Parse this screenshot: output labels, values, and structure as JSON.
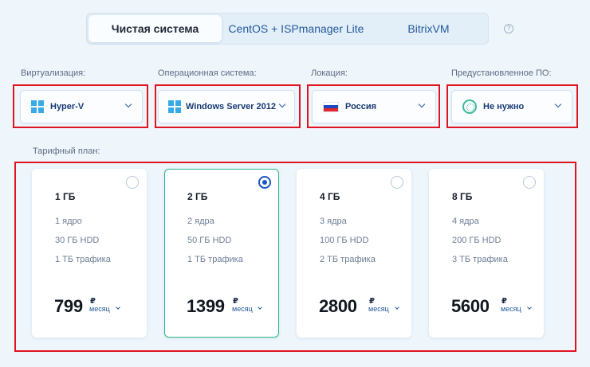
{
  "tabs": [
    {
      "label": "Чистая система",
      "active": true
    },
    {
      "label": "CentOS + ISPmanager Lite",
      "active": false
    },
    {
      "label": "BitrixVM",
      "active": false
    }
  ],
  "help_icon": "?",
  "filters": {
    "virtualization": {
      "label": "Виртуализация:",
      "value": "Hyper-V",
      "icon": "windows-logo"
    },
    "os": {
      "label": "Операционная система:",
      "value": "Windows Server 2012",
      "icon": "windows-logo"
    },
    "location": {
      "label": "Локация:",
      "value": "Россия",
      "icon": "russia-flag"
    },
    "software": {
      "label": "Предустановленное ПО:",
      "value": "Не нужно",
      "icon": "none-icon"
    }
  },
  "plans_label": "Тарифный план:",
  "plans": [
    {
      "ram": "1 ГБ",
      "cores": "1 ядро",
      "disk": "30 ГБ HDD",
      "traffic": "1 ТБ трафика",
      "price": "799",
      "currency": "₽",
      "period": "месяц",
      "selected": false
    },
    {
      "ram": "2 ГБ",
      "cores": "2 ядра",
      "disk": "50 ГБ HDD",
      "traffic": "1 ТБ трафика",
      "price": "1399",
      "currency": "₽",
      "period": "месяц",
      "selected": true
    },
    {
      "ram": "4 ГБ",
      "cores": "3 ядра",
      "disk": "100 ГБ HDD",
      "traffic": "2 ТБ трафика",
      "price": "2800",
      "currency": "₽",
      "period": "месяц",
      "selected": false
    },
    {
      "ram": "8 ГБ",
      "cores": "4 ядра",
      "disk": "200 ГБ HDD",
      "traffic": "3 ТБ трафика",
      "price": "5600",
      "currency": "₽",
      "period": "месяц",
      "selected": false
    }
  ],
  "colors": {
    "accent": "#1756c3",
    "selected_border": "#2db587",
    "highlight_frame": "#e01420",
    "background": "#eef6fc"
  }
}
